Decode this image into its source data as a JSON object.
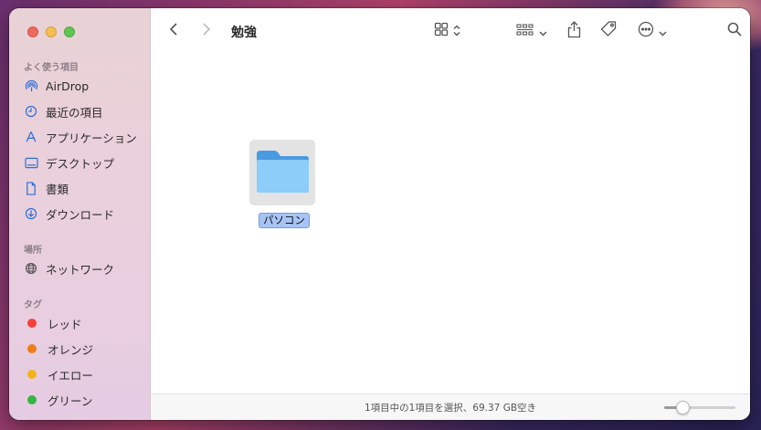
{
  "window": {
    "title": "勉強"
  },
  "sidebar": {
    "favorites_title": "よく使う項目",
    "favorites": [
      {
        "label": "AirDrop",
        "icon": "airdrop-icon"
      },
      {
        "label": "最近の項目",
        "icon": "clock-icon"
      },
      {
        "label": "アプリケーション",
        "icon": "applications-icon"
      },
      {
        "label": "デスクトップ",
        "icon": "desktop-icon"
      },
      {
        "label": "書類",
        "icon": "document-icon"
      },
      {
        "label": "ダウンロード",
        "icon": "download-icon"
      }
    ],
    "locations_title": "場所",
    "locations": [
      {
        "label": "ネットワーク",
        "icon": "network-icon"
      }
    ],
    "tags_title": "タグ",
    "tags": [
      {
        "label": "レッド",
        "color": "#f5413a"
      },
      {
        "label": "オレンジ",
        "color": "#f07d1a"
      },
      {
        "label": "イエロー",
        "color": "#f3b21b"
      },
      {
        "label": "グリーン",
        "color": "#34b544"
      }
    ]
  },
  "toolbar": {
    "back_icon": "chevron-left-icon",
    "forward_icon": "chevron-right-icon",
    "view_icon": "grid-view-icon",
    "group_icon": "group-by-icon",
    "share_icon": "share-icon",
    "tag_icon": "tag-icon",
    "more_icon": "ellipsis-circle-icon",
    "search_icon": "search-icon"
  },
  "content": {
    "items": [
      {
        "name": "パソコン",
        "kind": "folder",
        "selected": true
      }
    ]
  },
  "statusbar": {
    "text": "1項目中の1項目を選択、69.37 GB空き",
    "icon_size_level": 0.26
  }
}
